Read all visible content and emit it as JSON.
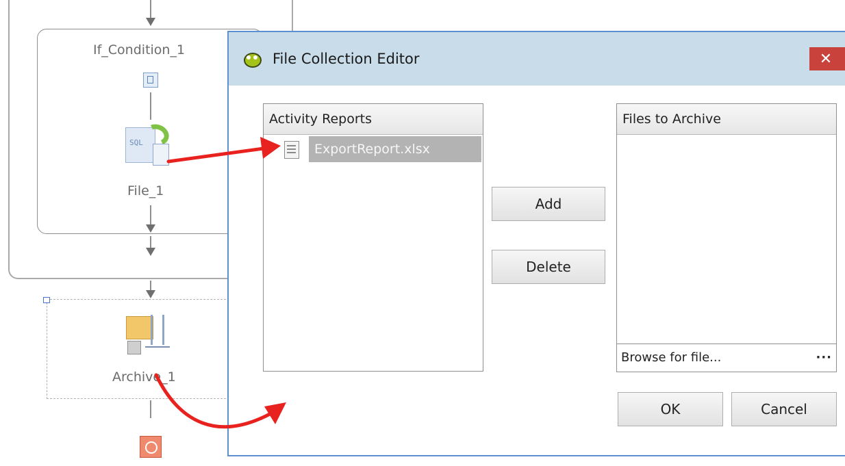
{
  "canvas": {
    "if_condition_label": "If_Condition_1",
    "file_label": "File_1",
    "archive_label": "Archive_1",
    "file_icon_text": "SQL"
  },
  "dialog": {
    "title": "File Collection Editor",
    "close_glyph": "✕",
    "left_panel": {
      "header": "Activity Reports",
      "items": [
        {
          "name": "ExportReport.xlsx",
          "selected": true
        }
      ]
    },
    "right_panel": {
      "header": "Files to Archive",
      "items": []
    },
    "buttons": {
      "add": "Add",
      "delete": "Delete",
      "ok": "OK",
      "cancel": "Cancel"
    },
    "browse": {
      "label": "Browse for file...",
      "ellipsis": "···"
    }
  },
  "colors": {
    "titlebar": "#c9dcea",
    "close": "#c9423c",
    "selection": "#b3b3b3",
    "annotation_arrow": "#e8231f"
  }
}
